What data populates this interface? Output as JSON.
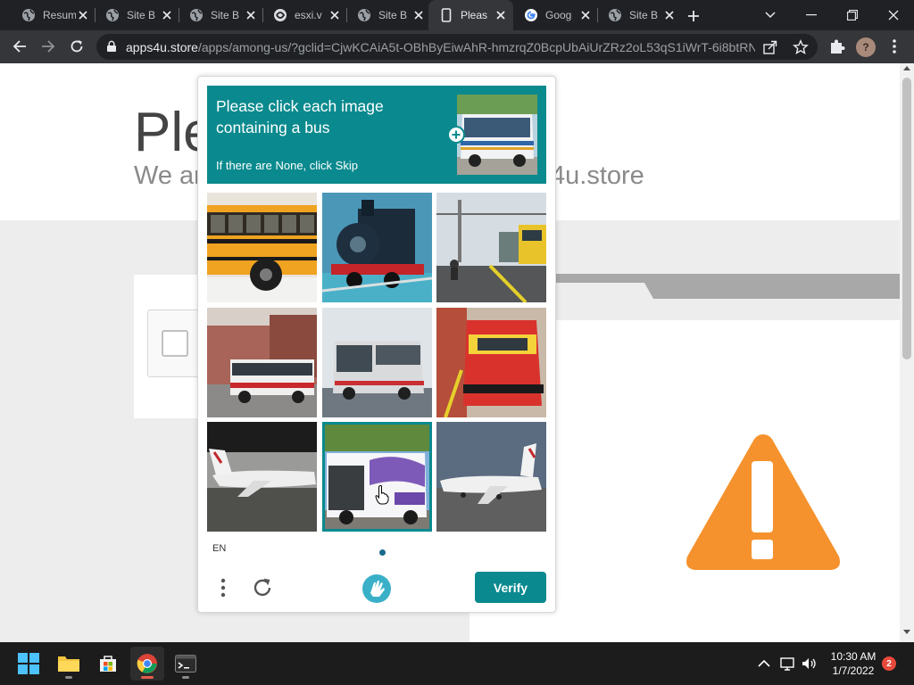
{
  "browser": {
    "tabs": [
      {
        "title": "Resume",
        "icon": "globe-icon"
      },
      {
        "title": "Site B",
        "icon": "globe-icon"
      },
      {
        "title": "Site B",
        "icon": "globe-icon"
      },
      {
        "title": "esxi.v",
        "icon": "globe-icon"
      },
      {
        "title": "Site B",
        "icon": "globe-icon"
      },
      {
        "title": "Pleas",
        "icon": "phone-icon",
        "active": true
      },
      {
        "title": "Goog",
        "icon": "google-icon"
      },
      {
        "title": "Site B",
        "icon": "globe-icon"
      }
    ],
    "url_host": "apps4u.store",
    "url_path": "/apps/among-us/?gclid=CjwKCAiA5t-OBhByEiwAhR-hmzrqZ0BcpUbAiUrZRz2oL53qS1iWrT-6i8btRN...",
    "profile_initial": "?"
  },
  "page": {
    "title": "Ple",
    "subtitle": "We ar",
    "domain_fragment": "4u.store"
  },
  "captcha": {
    "prompt": "Please click each image containing a bus",
    "sub": "If there are None, click Skip",
    "language": "EN",
    "verify_label": "Verify",
    "accent": "#0a8a8e",
    "images": [
      {
        "subject": "school bus",
        "selected": false
      },
      {
        "subject": "steam locomotive",
        "selected": false
      },
      {
        "subject": "train at platform",
        "selected": false
      },
      {
        "subject": "city bus",
        "selected": false
      },
      {
        "subject": "coach bus",
        "selected": false
      },
      {
        "subject": "red electric train",
        "selected": false
      },
      {
        "subject": "airplane",
        "selected": false
      },
      {
        "subject": "white bus",
        "selected": true
      },
      {
        "subject": "airplane",
        "selected": false
      }
    ]
  },
  "taskbar": {
    "time": "10:30 AM",
    "date": "1/7/2022",
    "notifications": "2"
  }
}
